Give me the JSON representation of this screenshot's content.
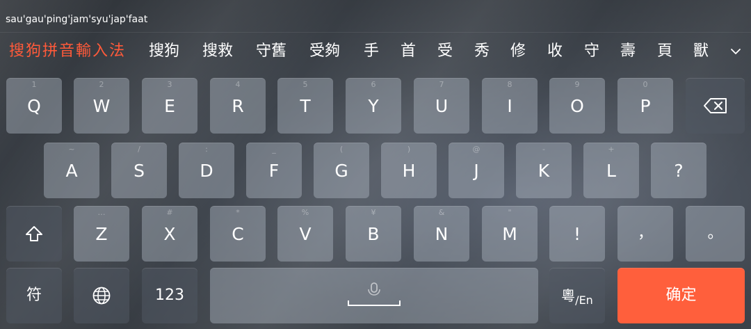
{
  "composition": "sau'gau'ping'jam'syu'jap'faat",
  "brand": "搜狗拼音輸入法",
  "candidates": [
    "搜狗",
    "搜救",
    "守舊",
    "受夠",
    "手",
    "首",
    "受",
    "秀",
    "修",
    "收",
    "守",
    "壽",
    "頁",
    "獸"
  ],
  "rows": {
    "row1": [
      {
        "label": "Q",
        "hint": "1"
      },
      {
        "label": "W",
        "hint": "2"
      },
      {
        "label": "E",
        "hint": "3"
      },
      {
        "label": "R",
        "hint": "4"
      },
      {
        "label": "T",
        "hint": "5"
      },
      {
        "label": "Y",
        "hint": "6"
      },
      {
        "label": "U",
        "hint": "7"
      },
      {
        "label": "I",
        "hint": "8"
      },
      {
        "label": "O",
        "hint": "9"
      },
      {
        "label": "P",
        "hint": "0"
      }
    ],
    "row2": [
      {
        "label": "A",
        "hint": "~"
      },
      {
        "label": "S",
        "hint": "/"
      },
      {
        "label": "D",
        "hint": ":"
      },
      {
        "label": "F",
        "hint": "_"
      },
      {
        "label": "G",
        "hint": "("
      },
      {
        "label": "H",
        "hint": ")"
      },
      {
        "label": "J",
        "hint": "@"
      },
      {
        "label": "K",
        "hint": "-"
      },
      {
        "label": "L",
        "hint": "+"
      },
      {
        "label": "?",
        "hint": ""
      }
    ],
    "row3": [
      {
        "label": "Z",
        "hint": "…"
      },
      {
        "label": "X",
        "hint": "#"
      },
      {
        "label": "C",
        "hint": "*"
      },
      {
        "label": "V",
        "hint": "%"
      },
      {
        "label": "B",
        "hint": "¥"
      },
      {
        "label": "N",
        "hint": "&"
      },
      {
        "label": "M",
        "hint": "\""
      },
      {
        "label": "!",
        "hint": ""
      },
      {
        "label": "，",
        "hint": ""
      },
      {
        "label": "。",
        "hint": ""
      }
    ]
  },
  "bottom": {
    "symbols": "符",
    "numbers": "123",
    "lang_main": "粵",
    "lang_sub": "/En",
    "enter": "确定"
  },
  "icons": {
    "backspace": "backspace-icon",
    "shift": "shift-icon",
    "globe": "globe-icon",
    "mic": "microphone-icon",
    "expand": "chevron-down-icon"
  },
  "colors": {
    "accent": "#ff5f3c",
    "brand": "#ff5a3a"
  }
}
